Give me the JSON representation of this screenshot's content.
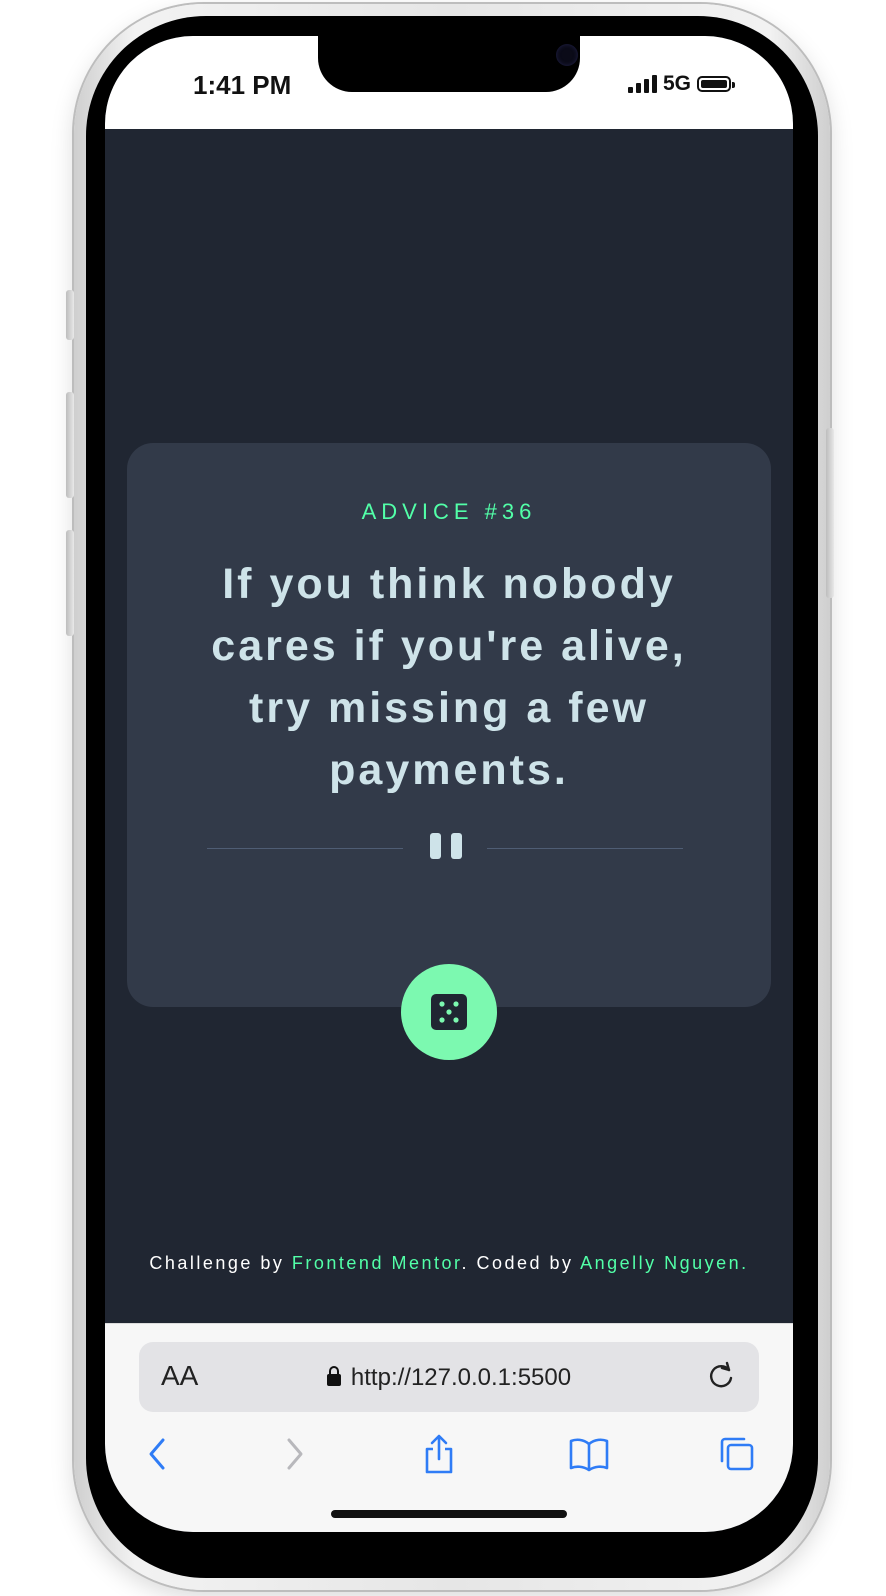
{
  "status_bar": {
    "time": "1:41 PM",
    "network": "5G"
  },
  "advice": {
    "label": "ADVICE #36",
    "quote": "If you think nobody cares if you're alive, try missing a few payments."
  },
  "footer": {
    "challenge_prefix": "Challenge by ",
    "challenge_link": "Frontend Mentor",
    "coded_prefix": ". Coded by ",
    "author_link": "Angelly Nguyen",
    "suffix": "."
  },
  "browser": {
    "aa_label": "AA",
    "url": "http://127.0.0.1:5500"
  },
  "colors": {
    "background": "#202632",
    "card": "#323a49",
    "accent": "#52ffa8",
    "text": "#cee3e9"
  },
  "icons": {
    "dice": "dice-icon",
    "pause_divider": "pause-divider-icon",
    "back": "chevron-left-icon",
    "forward": "chevron-right-icon",
    "share": "share-icon",
    "bookmarks": "book-icon",
    "tabs": "tabs-icon",
    "reload": "reload-icon",
    "lock": "lock-icon"
  }
}
